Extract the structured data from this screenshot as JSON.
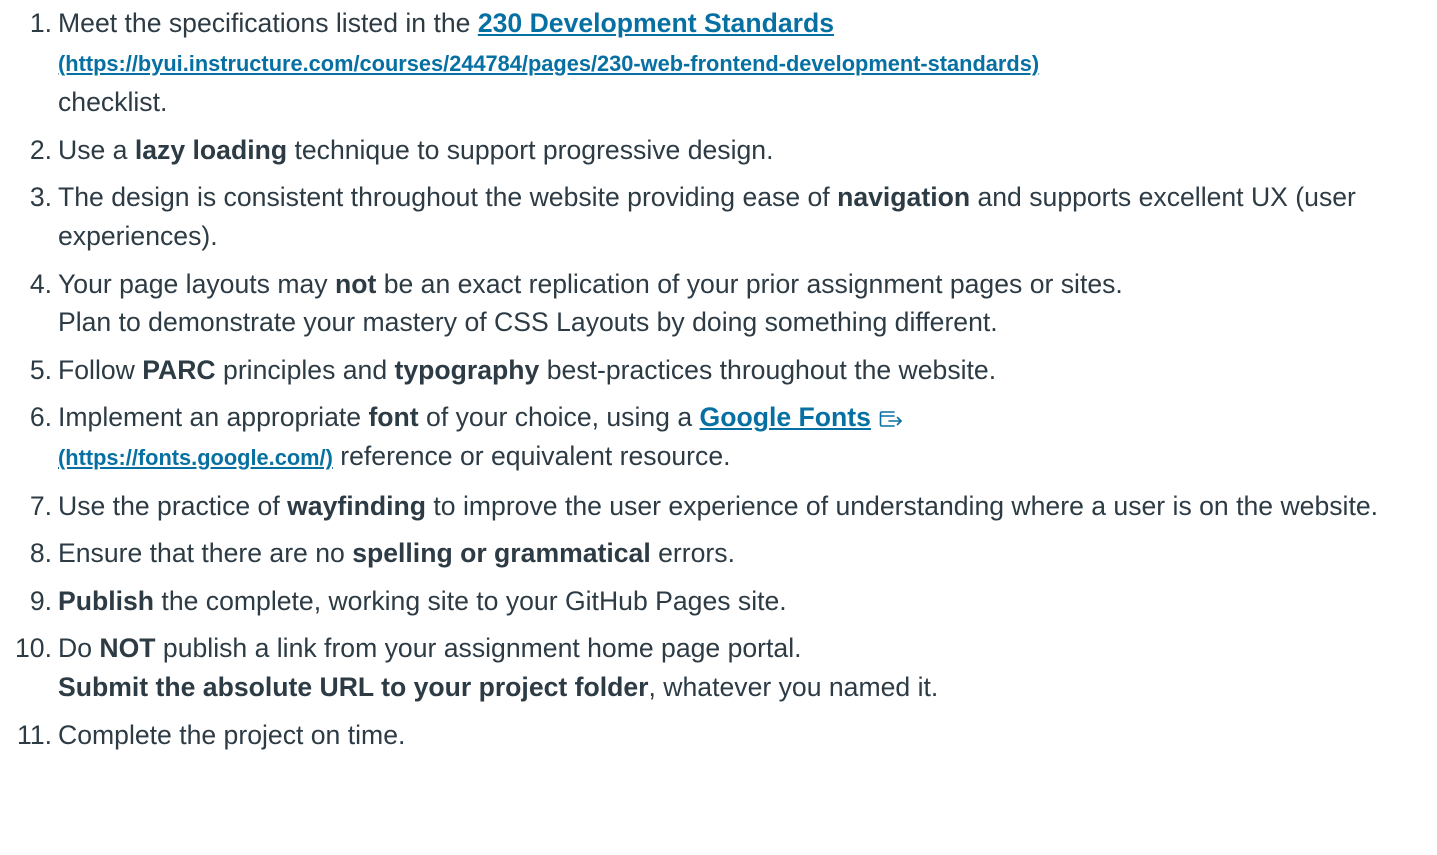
{
  "requirements": [
    {
      "num": "1",
      "before": "Meet the specifications listed in the ",
      "link_title": "230 Development Standards",
      "link_url": "(https://byui.instructure.com/courses/244784/pages/230-web-frontend-development-standards)",
      "after": "checklist."
    },
    {
      "num": "2",
      "before": "Use a ",
      "bold": "lazy loading",
      "after": " technique to support progressive design."
    },
    {
      "num": "3",
      "before": "The design is consistent throughout the website providing ease of ",
      "bold": "navigation",
      "after": " and supports excellent UX (user experiences)."
    },
    {
      "num": "4",
      "before": "Your page layouts may ",
      "bold": "not",
      "after": " be an exact replication of your prior assignment pages or sites.",
      "line2": "Plan to demonstrate your mastery of CSS Layouts by doing something different."
    },
    {
      "num": "5",
      "before": "Follow ",
      "bold": "PARC",
      "middle": " principles and ",
      "bold2": "typography",
      "after": " best-practices throughout the website."
    },
    {
      "num": "6",
      "before": "Implement an appropriate ",
      "bold": "font",
      "middle": " of your choice, using a ",
      "link_title": "Google Fonts",
      "link_url": "(https://fonts.google.com/)",
      "after": " reference or equivalent resource.",
      "icon": "external-link-icon"
    },
    {
      "num": "7",
      "before": "Use the practice of ",
      "bold": "wayfinding",
      "after": " to improve the user experience of understanding where a user is on the website."
    },
    {
      "num": "8",
      "before": "Ensure that there are no ",
      "bold": "spelling or grammatical",
      "after": " errors."
    },
    {
      "num": "9",
      "bold": "Publish",
      "after": " the complete, working site to your GitHub Pages site."
    },
    {
      "num": "10",
      "before": "Do ",
      "bold": "NOT",
      "after": " publish a link from your assignment home page portal.",
      "line2_bold": "Submit the absolute URL to your project folder",
      "line2_after": ", whatever you named it."
    },
    {
      "num": "11",
      "before": "Complete the project on time."
    }
  ],
  "colors": {
    "text": "#2d3b45",
    "link": "#0770a3"
  }
}
